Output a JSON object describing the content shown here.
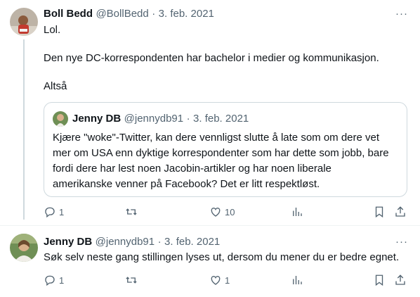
{
  "tweet1": {
    "name": "Boll Bedd",
    "handle": "@BollBedd",
    "sep": "·",
    "date": "3. feb. 2021",
    "more": "···",
    "lines": [
      "Lol.",
      "Den nye DC-korrespondenten har bachelor i medier og kommunikasjon.",
      "Altså"
    ],
    "quote": {
      "name": "Jenny DB",
      "handle": "@jennydb91",
      "sep": "·",
      "date": "3. feb. 2021",
      "lines": [
        "Kjære \"woke\"-Twitter, kan dere vennligst slutte å late som om dere vet",
        "mer om USA enn dyktige korrespondenter som har dette som jobb, bare",
        "fordi dere har lest noen Jacobin-artikler og har noen liberale",
        "amerikanske venner på Facebook? Det er litt respektløst."
      ]
    },
    "actions": {
      "reply": "1",
      "retweet": "",
      "like": "10"
    }
  },
  "tweet2": {
    "name": "Jenny DB",
    "handle": "@jennydb91",
    "sep": "·",
    "date": "3. feb. 2021",
    "more": "···",
    "text": "Søk selv neste gang stillingen lyses ut, dersom du mener du er bedre egnet.",
    "actions": {
      "reply": "1",
      "retweet": "",
      "like": "1"
    }
  },
  "icons": {
    "reply": "reply-icon",
    "retweet": "retweet-icon",
    "like": "heart-icon",
    "views": "views-icon",
    "bookmark": "bookmark-icon",
    "share": "share-icon"
  },
  "colors": {
    "text": "#0f1419",
    "muted": "#536471",
    "border": "#cfd9de"
  }
}
